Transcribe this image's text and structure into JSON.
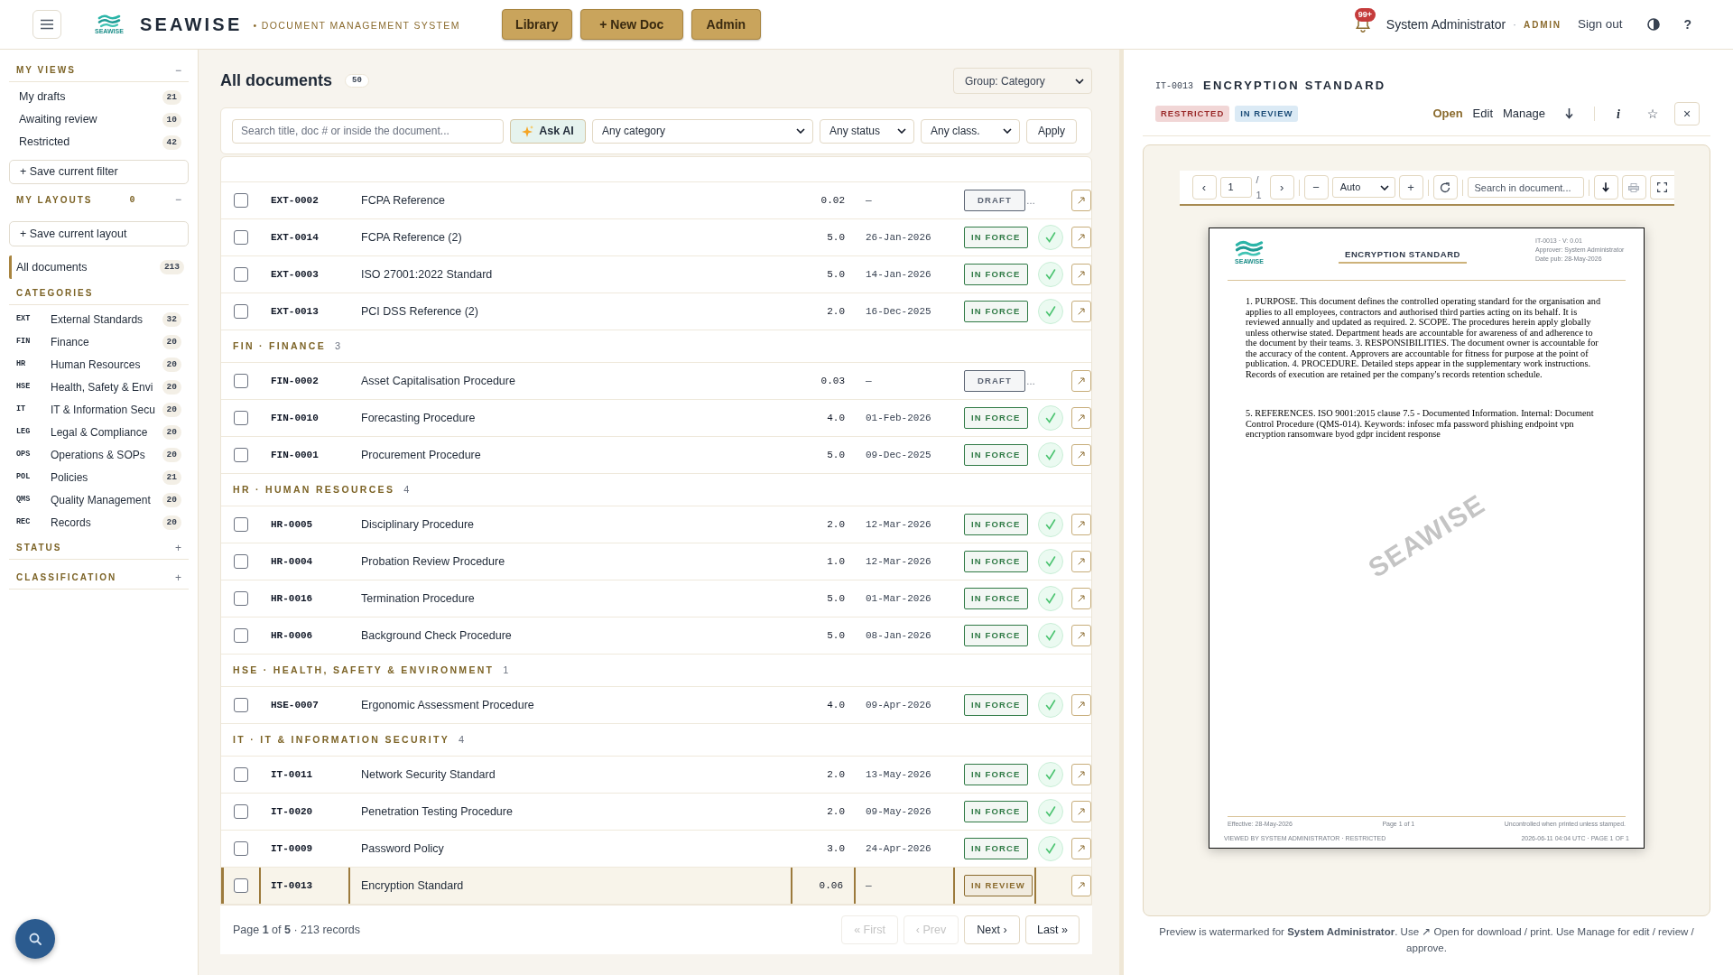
{
  "header": {
    "logo_caption": "SEAWISE",
    "brand": "SEAWISE",
    "tagline": "• DOCUMENT MANAGEMENT SYSTEM",
    "nav_buttons": [
      {
        "label": "Library"
      },
      {
        "label": "+ New Doc"
      },
      {
        "label": "Admin"
      }
    ],
    "notification_badge": "99+",
    "user_name": "System Administrator",
    "separator": "·",
    "role": "ADMIN",
    "sign_out": "Sign out",
    "help": "?"
  },
  "sidebar": {
    "my_views": {
      "title": "MY VIEWS",
      "toggle": "−",
      "items": [
        {
          "label": "My drafts",
          "count": "21",
          "selected": false
        },
        {
          "label": "Awaiting review",
          "count": "10",
          "selected": false
        },
        {
          "label": "Restricted",
          "count": "42",
          "selected": false
        }
      ],
      "save_button": "+ Save current filter"
    },
    "my_layouts": {
      "title": "MY LAYOUTS",
      "count": "0",
      "toggle": "−",
      "save_button": "+ Save current layout"
    },
    "all_documents": {
      "label": "All documents",
      "count": "213",
      "selected": true
    },
    "categories": {
      "title": "CATEGORIES",
      "items": [
        {
          "code": "EXT",
          "name": "External Standards",
          "count": "32",
          "selected": false
        },
        {
          "code": "FIN",
          "name": "Finance",
          "count": "20",
          "selected": false
        },
        {
          "code": "HR",
          "name": "Human Resources",
          "count": "20",
          "selected": false
        },
        {
          "code": "HSE",
          "name": "Health, Safety & Envi",
          "count": "20",
          "selected": false
        },
        {
          "code": "IT",
          "name": "IT & Information Secu",
          "count": "20",
          "selected": false
        },
        {
          "code": "LEG",
          "name": "Legal & Compliance",
          "count": "20",
          "selected": false
        },
        {
          "code": "OPS",
          "name": "Operations & SOPs",
          "count": "20",
          "selected": false
        },
        {
          "code": "POL",
          "name": "Policies",
          "count": "21",
          "selected": false
        },
        {
          "code": "QMS",
          "name": "Quality Management",
          "count": "20",
          "selected": false
        },
        {
          "code": "REC",
          "name": "Records",
          "count": "20",
          "selected": false
        }
      ]
    },
    "filter_sections": [
      {
        "title": "STATUS",
        "toggle": "+"
      },
      {
        "title": "CLASSIFICATION",
        "toggle": "+"
      }
    ]
  },
  "main": {
    "title": "All documents",
    "count": "50",
    "group_by": "Group: Category",
    "filters": {
      "search_placeholder": "Search title, doc # or inside the document...",
      "ask_ai": "Ask AI",
      "selects": [
        {
          "value": "Any category"
        },
        {
          "value": "Any status"
        },
        {
          "value": "Any class."
        }
      ],
      "apply": "Apply"
    },
    "rows": [
      {
        "kind": "document",
        "doc_no": "EXT-0002",
        "title": "FCPA Reference",
        "version": "0.02",
        "date": "—",
        "status": {
          "label": "DRAFT",
          "color": "#5b6473"
        },
        "more": "…",
        "approved": false,
        "checked": false,
        "selected": false
      },
      {
        "kind": "document",
        "doc_no": "EXT-0014",
        "title": "FCPA Reference (2)",
        "version": "5.0",
        "date": "26-Jan-2026",
        "status": {
          "label": "IN FORCE",
          "color": "#2f7a45"
        },
        "approved": true,
        "checked": false,
        "selected": false
      },
      {
        "kind": "document",
        "doc_no": "EXT-0003",
        "title": "ISO 27001:2022 Standard",
        "version": "5.0",
        "date": "14-Jan-2026",
        "status": {
          "label": "IN FORCE",
          "color": "#2f7a45"
        },
        "approved": true,
        "checked": false,
        "selected": false
      },
      {
        "kind": "document",
        "doc_no": "EXT-0013",
        "title": "PCI DSS Reference (2)",
        "version": "2.0",
        "date": "16-Dec-2025",
        "status": {
          "label": "IN FORCE",
          "color": "#2f7a45"
        },
        "approved": true,
        "checked": false,
        "selected": false
      },
      {
        "kind": "group",
        "label": "FIN · FINANCE",
        "count": "3"
      },
      {
        "kind": "document",
        "doc_no": "FIN-0002",
        "title": "Asset Capitalisation Procedure",
        "version": "0.03",
        "date": "—",
        "status": {
          "label": "DRAFT",
          "color": "#5b6473"
        },
        "more": "…",
        "approved": false,
        "checked": false,
        "selected": false
      },
      {
        "kind": "document",
        "doc_no": "FIN-0010",
        "title": "Forecasting Procedure",
        "version": "4.0",
        "date": "01-Feb-2026",
        "status": {
          "label": "IN FORCE",
          "color": "#2f7a45"
        },
        "approved": true,
        "checked": false,
        "selected": false
      },
      {
        "kind": "document",
        "doc_no": "FIN-0001",
        "title": "Procurement Procedure",
        "version": "5.0",
        "date": "09-Dec-2025",
        "status": {
          "label": "IN FORCE",
          "color": "#2f7a45"
        },
        "approved": true,
        "checked": false,
        "selected": false
      },
      {
        "kind": "group",
        "label": "HR · HUMAN RESOURCES",
        "count": "4"
      },
      {
        "kind": "document",
        "doc_no": "HR-0005",
        "title": "Disciplinary Procedure",
        "version": "2.0",
        "date": "12-Mar-2026",
        "status": {
          "label": "IN FORCE",
          "color": "#2f7a45"
        },
        "approved": true,
        "checked": false,
        "selected": false
      },
      {
        "kind": "document",
        "doc_no": "HR-0004",
        "title": "Probation Review Procedure",
        "version": "1.0",
        "date": "12-Mar-2026",
        "status": {
          "label": "IN FORCE",
          "color": "#2f7a45"
        },
        "approved": true,
        "checked": false,
        "selected": false
      },
      {
        "kind": "document",
        "doc_no": "HR-0016",
        "title": "Termination Procedure",
        "version": "5.0",
        "date": "01-Mar-2026",
        "status": {
          "label": "IN FORCE",
          "color": "#2f7a45"
        },
        "approved": true,
        "checked": false,
        "selected": false
      },
      {
        "kind": "document",
        "doc_no": "HR-0006",
        "title": "Background Check Procedure",
        "version": "5.0",
        "date": "08-Jan-2026",
        "status": {
          "label": "IN FORCE",
          "color": "#2f7a45"
        },
        "approved": true,
        "checked": false,
        "selected": false
      },
      {
        "kind": "group",
        "label": "HSE · HEALTH, SAFETY & ENVIRONMENT",
        "count": "1"
      },
      {
        "kind": "document",
        "doc_no": "HSE-0007",
        "title": "Ergonomic Assessment Procedure",
        "version": "4.0",
        "date": "09-Apr-2026",
        "status": {
          "label": "IN FORCE",
          "color": "#2f7a45"
        },
        "approved": true,
        "checked": false,
        "selected": false
      },
      {
        "kind": "group",
        "label": "IT · IT & INFORMATION SECURITY",
        "count": "4"
      },
      {
        "kind": "document",
        "doc_no": "IT-0011",
        "title": "Network Security Standard",
        "version": "2.0",
        "date": "13-May-2026",
        "status": {
          "label": "IN FORCE",
          "color": "#2f7a45"
        },
        "approved": true,
        "checked": false,
        "selected": false
      },
      {
        "kind": "document",
        "doc_no": "IT-0020",
        "title": "Penetration Testing Procedure",
        "version": "2.0",
        "date": "09-May-2026",
        "status": {
          "label": "IN FORCE",
          "color": "#2f7a45"
        },
        "approved": true,
        "checked": false,
        "selected": false
      },
      {
        "kind": "document",
        "doc_no": "IT-0009",
        "title": "Password Policy",
        "version": "3.0",
        "date": "24-Apr-2026",
        "status": {
          "label": "IN FORCE",
          "color": "#2f7a45"
        },
        "approved": true,
        "checked": false,
        "selected": false
      },
      {
        "kind": "document",
        "doc_no": "IT-0013",
        "title": "Encryption Standard",
        "version": "0.06",
        "date": "—",
        "status": {
          "label": "IN REVIEW",
          "color": "#8b6b2e"
        },
        "approved": false,
        "checked": false,
        "selected": true
      }
    ],
    "pagination": {
      "summary": "Page **1** of **5** · 213 records",
      "buttons": [
        {
          "label": "« First",
          "disabled": true
        },
        {
          "label": "‹ Prev",
          "disabled": true
        },
        {
          "label": "Next ›",
          "disabled": false
        },
        {
          "label": "Last »",
          "disabled": false
        }
      ]
    }
  },
  "preview": {
    "doc_no": "IT-0013",
    "title": "ENCRYPTION STANDARD",
    "badges": [
      {
        "label": "RESTRICTED",
        "kind": "restricted"
      },
      {
        "label": "IN REVIEW",
        "kind": "in_review"
      }
    ],
    "actions": [
      {
        "label": "Open",
        "kind": "primary"
      },
      {
        "label": "Edit",
        "kind": "plain"
      },
      {
        "label": "Manage",
        "kind": "plain"
      }
    ],
    "info": "i",
    "star": "☆",
    "close": "×",
    "viewer": {
      "prev": "‹",
      "page": "1",
      "page_count": "/ 1",
      "next": "›",
      "zoom_out": "−",
      "zoom": "Auto",
      "zoom_in": "+",
      "search_placeholder": "Search in document..."
    },
    "document": {
      "logo_caption": "SEAWISE",
      "title": "ENCRYPTION STANDARD",
      "meta": [
        "IT-0013 · V: 0.01",
        "Approver: System Administrator",
        "Date pub: 28-May-2026"
      ],
      "paragraphs": [
        "1. PURPOSE. This document defines the controlled operating standard for the organisation and applies to all employees, contractors and authorised third parties acting on its behalf. It is reviewed annually and updated as required. 2. SCOPE. The procedures herein apply globally unless otherwise stated. Department heads are accountable for awareness of and adherence to the document by their teams. 3. RESPONSIBILITIES. The document owner is accountable for the accuracy of the content. Approvers are accountable for fitness for purpose at the point of publication. 4. PROCEDURE. Detailed steps appear in the supplementary work instructions. Records of execution are retained per the company's records retention schedule.",
        "5. REFERENCES. ISO 9001:2015 clause 7.5 - Documented Information. Internal: Document Control Procedure (QMS-014). Keywords: infosec mfa password phishing endpoint vpn encryption ransomware byod gdpr incident response"
      ],
      "watermark": "SEAWISE",
      "footer": [
        "Effective: 28-May-2026",
        "Page 1 of 1",
        "Uncontrolled when printed unless stamped."
      ],
      "stamp": [
        "VIEWED BY SYSTEM ADMINISTRATOR · RESTRICTED",
        "2026-06-11 04:04 UTC · PAGE 1 OF 1"
      ]
    },
    "note": "Preview is watermarked for **System Administrator**. Use ↗ Open for download / print. Use Manage for edit / review / approve."
  }
}
